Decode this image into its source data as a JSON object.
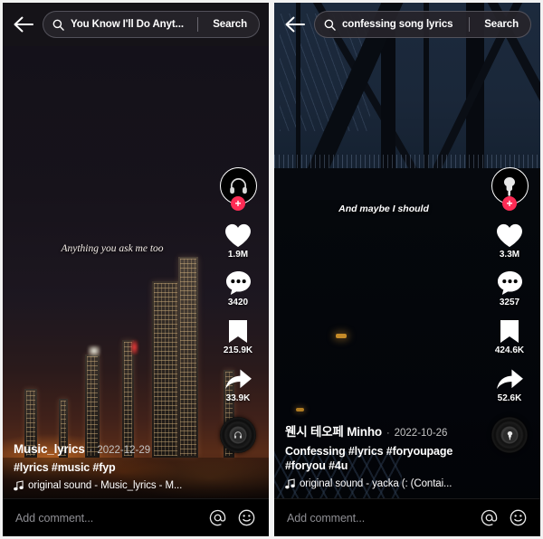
{
  "panels": [
    {
      "id": "left",
      "search": {
        "query": "You Know I'll Do Anyt...",
        "button_label": "Search",
        "icon": "search-icon",
        "back_icon": "back-arrow-icon"
      },
      "video": {
        "caption": "Anything you ask me too",
        "scene": "night-cityscape"
      },
      "rail": {
        "avatar_icon": "headphones-avatar-icon",
        "follow_label": "+",
        "like_count": "1.9M",
        "comment_count": "3420",
        "bookmark_count": "215.9K",
        "share_count": "33.9K",
        "disc_icon": "headphones-disc-icon"
      },
      "info": {
        "username": "Music_lyrics",
        "separator": "·",
        "date": "2022-12-29",
        "description": "#lyrics #music #fyp",
        "music": "original sound - Music_lyrics - M..."
      },
      "comment": {
        "placeholder": "Add comment...",
        "mention_icon": "at-mention-icon",
        "emoji_icon": "smiley-emoji-icon"
      }
    },
    {
      "id": "right",
      "search": {
        "query": "confessing song lyrics",
        "button_label": "Search",
        "icon": "search-icon",
        "back_icon": "back-arrow-icon"
      },
      "video": {
        "caption": "And maybe I should",
        "scene": "steel-bridge-truss"
      },
      "rail": {
        "avatar_icon": "earbuds-avatar-icon",
        "follow_label": "+",
        "like_count": "3.3M",
        "comment_count": "3257",
        "bookmark_count": "424.6K",
        "share_count": "52.6K",
        "disc_icon": "earbuds-disc-icon"
      },
      "info": {
        "username": "웬시 테오페 Minho",
        "separator": "·",
        "date": "2022-10-26",
        "description": "Confessing #lyrics #foryoupage #foryou #4u",
        "music": "original sound - yacka (: (Contai..."
      },
      "comment": {
        "placeholder": "Add comment...",
        "mention_icon": "at-mention-icon",
        "emoji_icon": "smiley-emoji-icon"
      }
    }
  ],
  "colors": {
    "accent": "#fe2c55",
    "background": "#000000",
    "text": "#ffffff",
    "muted": "#8e8e93"
  }
}
